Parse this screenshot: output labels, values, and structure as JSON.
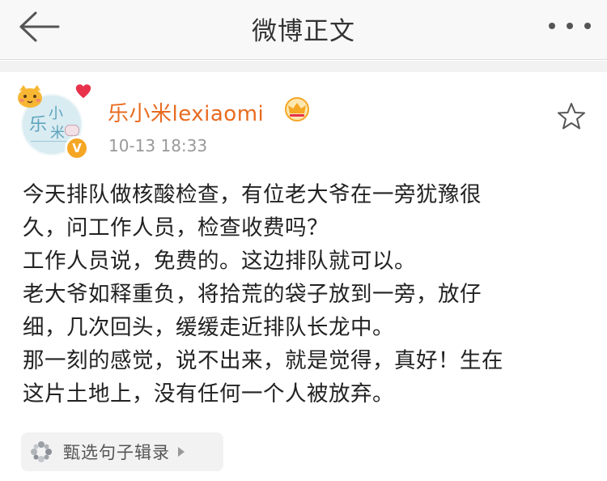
{
  "header": {
    "title": "微博正文",
    "back_icon": "back-arrow-icon",
    "more_icon": "more-dots-icon"
  },
  "author": {
    "name": "乐小米lexiaomi",
    "badge_icon": "crown-icon",
    "verified_icon": "verified-v-icon",
    "verified_text": "V",
    "avatar": {
      "chars": [
        "乐",
        "小",
        "米"
      ]
    }
  },
  "post": {
    "time": "10-13 18:33",
    "lines": [
      "今天排队做核酸检查，有位老大爷在一旁犹豫很",
      "久，问工作人员，检查收费吗？",
      "工作人员说，免费的。这边排队就可以。",
      "老大爷如释重负，将拾荒的袋子放到一旁，放仔",
      "细，几次回头，缓缓走近排队长龙中。",
      "那一刻的感觉，说不出来，就是觉得，真好！生在",
      "这片土地上，没有任何一个人被放弃。"
    ]
  },
  "actions": {
    "favorite_icon": "star-outline-icon",
    "tag_icon": "flower-icon",
    "tag_label": "甄选句子辑录"
  },
  "colors": {
    "username": "#e86b20",
    "verified": "#f5a623",
    "crown": "#f5a623",
    "timestamp": "#999999"
  }
}
